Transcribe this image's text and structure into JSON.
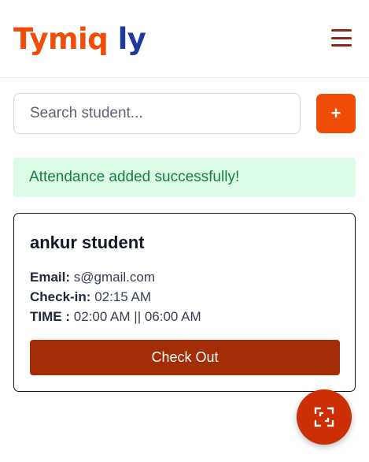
{
  "header": {
    "logo_part1": "Tymiq",
    "logo_part2": "ly",
    "menu_icon": "hamburger-menu-icon"
  },
  "search": {
    "placeholder": "Search student...",
    "value": "",
    "add_label": "+"
  },
  "alert": {
    "message": "Attendance added successfully!"
  },
  "student_card": {
    "name": "ankur student",
    "email_label": "Email:",
    "email_value": "s@gmail.com",
    "checkin_label": "Check-in:",
    "checkin_value": "02:15 AM",
    "time_label": "TIME :",
    "time_value": "02:00 AM || 06:00 AM",
    "checkout_label": "Check Out"
  },
  "fab": {
    "icon": "scan-icon"
  },
  "colors": {
    "brand_orange": "#f04e08",
    "brand_blue": "#1e3a9e",
    "checkout_button": "#a32d06",
    "alert_bg": "#dcfce7",
    "alert_text": "#15803d"
  }
}
